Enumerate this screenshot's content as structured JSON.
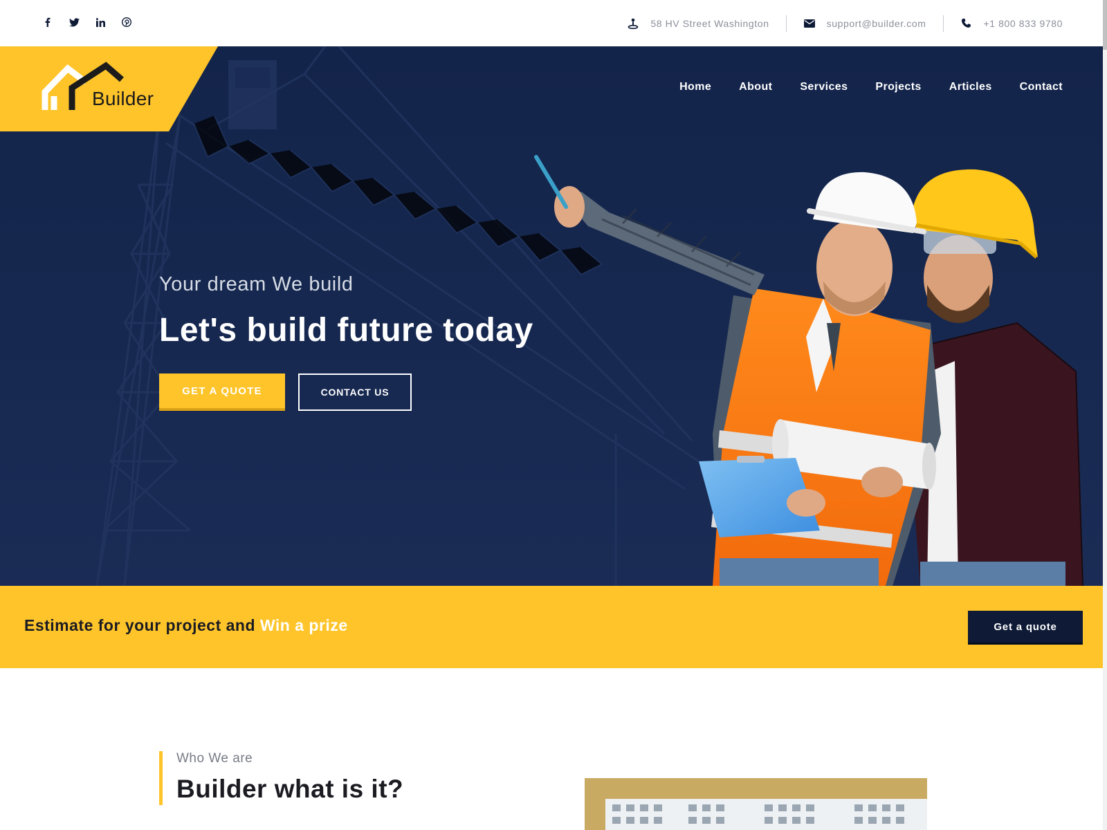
{
  "topbar": {
    "social": [
      {
        "icon": "facebook-icon",
        "glyph": "f"
      },
      {
        "icon": "twitter-icon",
        "glyph": "t"
      },
      {
        "icon": "linkedin-icon",
        "glyph": "in"
      },
      {
        "icon": "pinterest-icon",
        "glyph": "p"
      }
    ],
    "address": "58 HV Street Washington",
    "email": "support@builder.com",
    "phone": "+1 800 833 9780"
  },
  "header": {
    "logo_text": "Builder",
    "nav": [
      "Home",
      "About",
      "Services",
      "Projects",
      "Articles",
      "Contact"
    ]
  },
  "hero": {
    "subtitle": "Your dream We build",
    "title": "Let's build future today",
    "primary_button": "GET A QUOTE",
    "secondary_button": "CONTACT US"
  },
  "cta": {
    "text_main": "Estimate for your project and ",
    "text_highlight": "Win a prize",
    "button": "Get a quote"
  },
  "about": {
    "eyebrow": "Who We are",
    "title": "Builder what is it?"
  },
  "colors": {
    "accent": "#fec42a",
    "navy": "#0e1a36",
    "hero_bg": "#15264d"
  }
}
